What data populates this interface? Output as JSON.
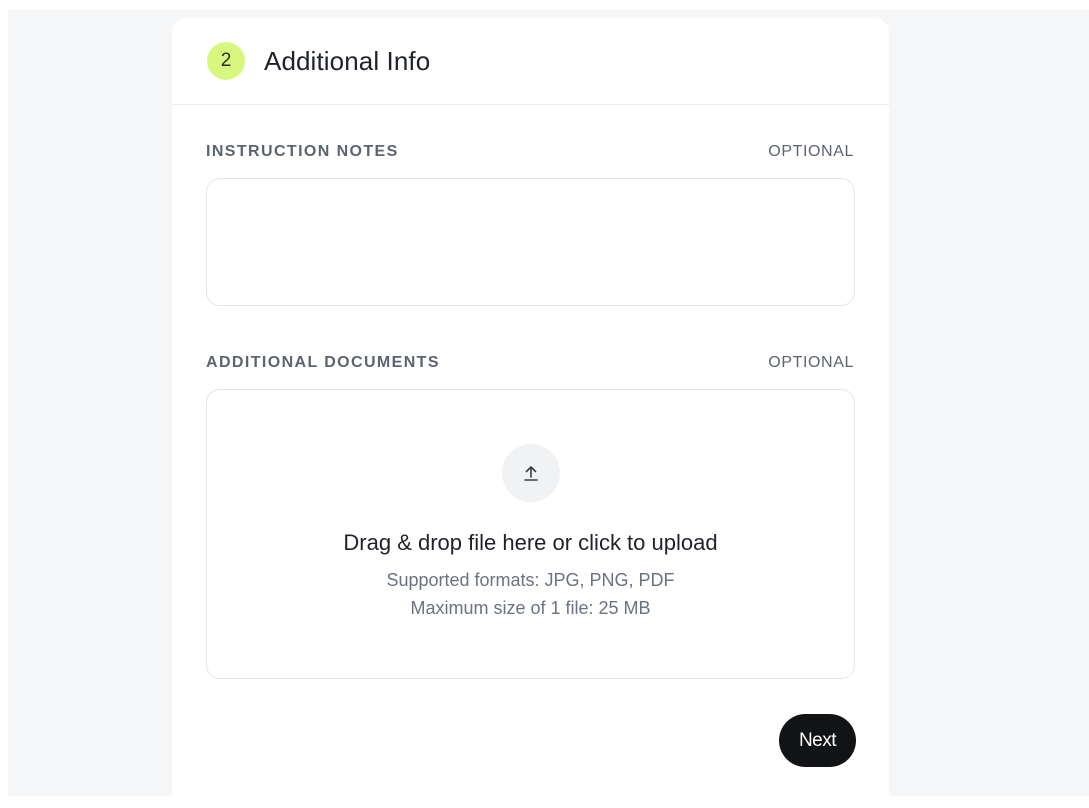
{
  "header": {
    "step_number": "2",
    "title": "Additional Info"
  },
  "instruction_notes": {
    "label": "INSTRUCTION NOTES",
    "optional": "OPTIONAL",
    "value": "",
    "placeholder": ""
  },
  "additional_documents": {
    "label": "ADDITIONAL DOCUMENTS",
    "optional": "OPTIONAL",
    "upload_icon": "upload-icon",
    "upload_main_text": "Drag & drop file here or click to upload",
    "supported_formats": "Supported formats: JPG, PNG, PDF",
    "max_size": "Maximum size of 1 file: 25 MB"
  },
  "actions": {
    "next_label": "Next"
  },
  "colors": {
    "step_badge": "#d7f77e",
    "next_button_bg": "#111315",
    "page_background": "#f5f6f8"
  }
}
